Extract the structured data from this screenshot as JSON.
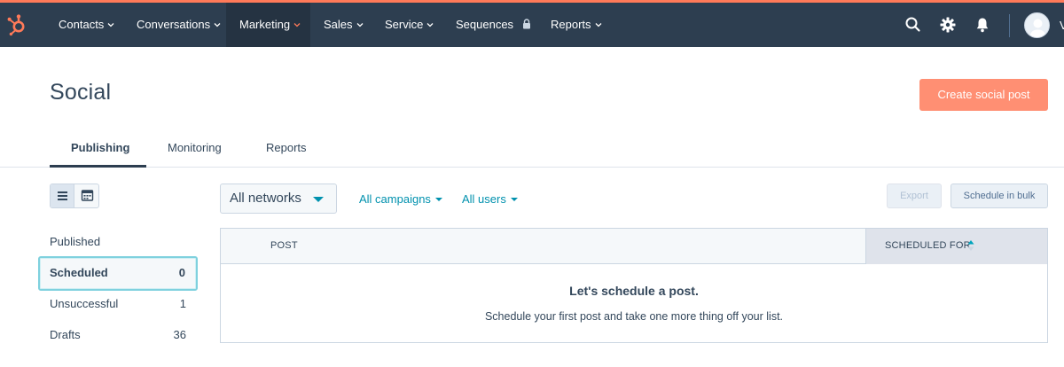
{
  "colors": {
    "accent": "#ff7a59",
    "nav_bg": "#2d3e50",
    "link": "#0091ae",
    "primary_button": "#ff8f73",
    "text": "#33475b"
  },
  "topnav": {
    "logo_icon": "hubspot-sprocket-icon",
    "items": [
      {
        "label": "Contacts"
      },
      {
        "label": "Conversations"
      },
      {
        "label": "Marketing",
        "active": true
      },
      {
        "label": "Sales"
      },
      {
        "label": "Service"
      },
      {
        "label": "Sequences",
        "icon": "lock-icon"
      },
      {
        "label": "Reports"
      }
    ],
    "icons": [
      "search-icon",
      "gear-icon",
      "bell-icon"
    ],
    "avatar_icon": "avatar-icon",
    "avatar_tail": "V"
  },
  "header": {
    "title": "Social",
    "create_button": "Create social post"
  },
  "tabs": [
    {
      "label": "Publishing",
      "active": true
    },
    {
      "label": "Monitoring"
    },
    {
      "label": "Reports"
    }
  ],
  "view_toggle": {
    "list_icon": "list-view-icon",
    "calendar_icon": "calendar-icon",
    "selected": "list"
  },
  "sidebar": {
    "items": [
      {
        "label": "Published",
        "count": ""
      },
      {
        "label": "Scheduled",
        "count": "0",
        "selected": true
      },
      {
        "label": "Unsuccessful",
        "count": "1"
      },
      {
        "label": "Drafts",
        "count": "36"
      }
    ]
  },
  "filters": {
    "network": "All networks",
    "campaigns": "All campaigns",
    "users": "All users"
  },
  "actions": {
    "export": "Export",
    "schedule_bulk": "Schedule in bulk"
  },
  "table": {
    "columns": [
      "POST",
      "SCHEDULED FOR"
    ],
    "empty_title": "Let's schedule a post.",
    "empty_subtitle": "Schedule your first post and take one more thing off your list."
  }
}
